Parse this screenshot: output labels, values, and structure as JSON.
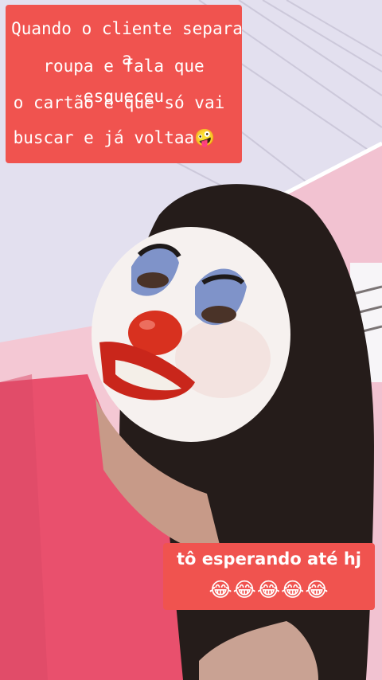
{
  "captions": {
    "top": {
      "line1": "Quando o cliente separa a",
      "line2": "roupa e fala que esqueceu",
      "line3": "o cartão e que só vai",
      "line4": "buscar e já voltaa🤪"
    },
    "bottom": {
      "line1": "tô esperando até hj",
      "line2": "😂😂😂😂😂"
    }
  },
  "colors": {
    "caption_background": "#f0534f",
    "caption_text": "#ffffff",
    "ceiling": "#e2dfee",
    "wall": "#f2c3d2",
    "shirt": "#e8506d",
    "hair": "#241b19"
  }
}
